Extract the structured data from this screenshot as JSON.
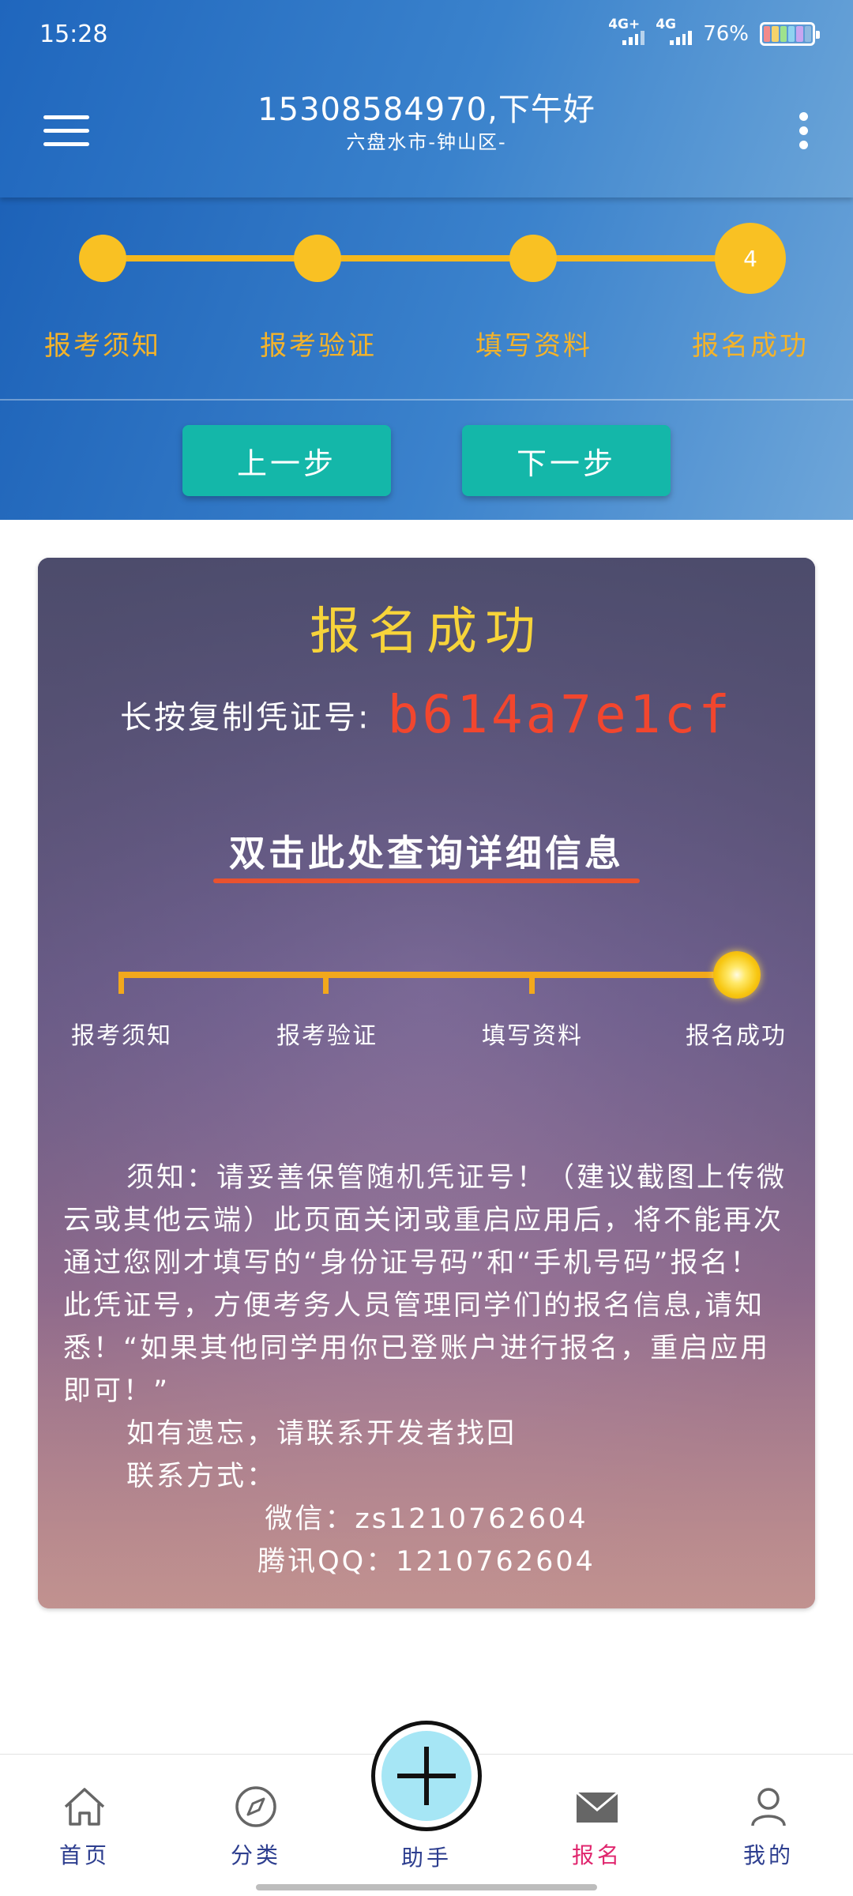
{
  "status_bar": {
    "time": "15:28",
    "signal1_label": "4G+",
    "signal2_label": "4G",
    "battery_text": "76%"
  },
  "header": {
    "title": "15308584970,下午好",
    "subtitle": "六盘水市-钟山区-"
  },
  "steps": {
    "items": [
      "报考须知",
      "报考验证",
      "填写资料",
      "报名成功"
    ],
    "current_number": "4",
    "prev_label": "上一步",
    "next_label": "下一步"
  },
  "card": {
    "title": "报名成功",
    "code_label": "长按复制凭证号:",
    "code_value": "b614a7e1cf",
    "query_link": "双击此处查询详细信息",
    "mini_steps": [
      "报考须知",
      "报考验证",
      "填写资料",
      "报名成功"
    ],
    "notice_main": "须知：请妥善保管随机凭证号！（建议截图上传微云或其他云端）此页面关闭或重启应用后，将不能再次通过您刚才填写的“身份证号码”和“手机号码”报名！此凭证号，方便考务人员管理同学们的报名信息,请知悉！“如果其他同学用你已登账户进行报名，重启应用即可！”",
    "notice_forget": "如有遗忘，请联系开发者找回",
    "contact_title": "联系方式：",
    "wechat": "微信：zs1210762604",
    "qq": "腾讯QQ：1210762604"
  },
  "bottom_nav": {
    "items": [
      "首页",
      "分类",
      "助手",
      "报名",
      "我的"
    ],
    "active": "报名"
  },
  "colors": {
    "header_blue": "#1f66bd",
    "step_yellow": "#f9c123",
    "button_teal": "#14b7a9",
    "code_red": "#f2462e",
    "active_nav": "#e0266e"
  }
}
